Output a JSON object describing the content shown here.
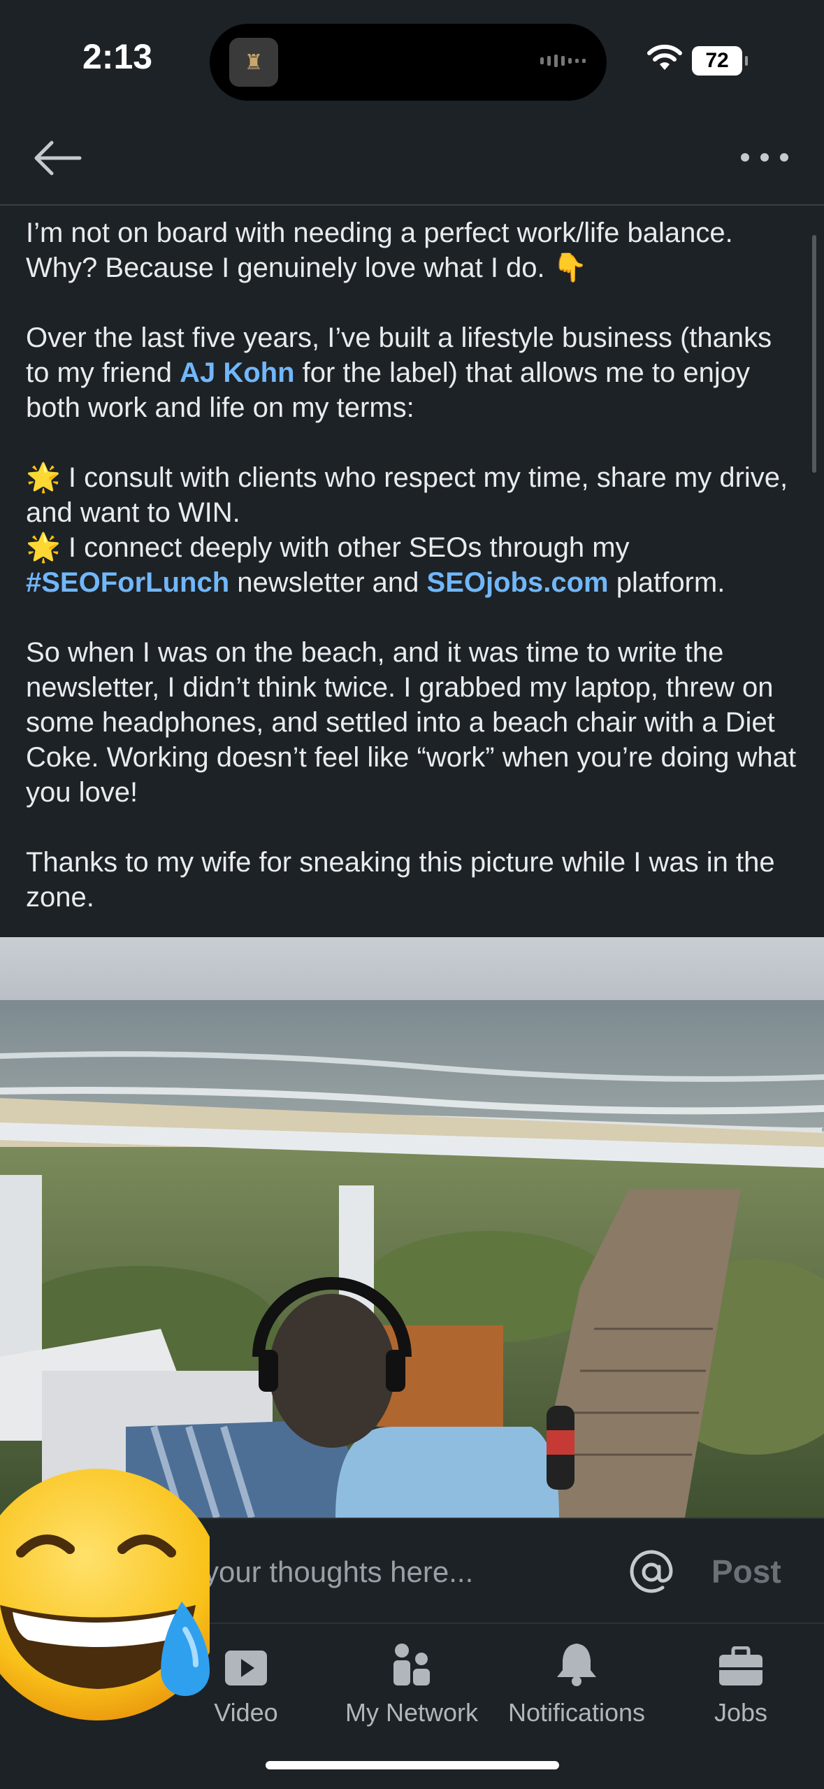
{
  "status_bar": {
    "time": "2:13",
    "battery": "72"
  },
  "post": {
    "paragraphs": [
      {
        "segments": [
          {
            "text": "I’m not on board with needing a perfect work/life balance. Why? Because I genuinely love what I do. "
          },
          {
            "text": "👇"
          }
        ]
      },
      {
        "segments": [
          {
            "text": "Over the last five years, I’ve built a lifestyle business (thanks to my friend "
          },
          {
            "text": "AJ Kohn",
            "link": true
          },
          {
            "text": " for the label) that allows me to enjoy both work and life on my terms:"
          }
        ]
      },
      {
        "segments": [
          {
            "text": "🌟 I consult with clients who respect my time, share my drive, and want to WIN."
          }
        ],
        "tight": true
      },
      {
        "segments": [
          {
            "text": "🌟 I connect deeply with other SEOs through my "
          },
          {
            "text": "#SEOForLunch",
            "link": true
          },
          {
            "text": " newsletter and "
          },
          {
            "text": "SEOjobs.com",
            "link": true
          },
          {
            "text": " platform."
          }
        ]
      },
      {
        "segments": [
          {
            "text": "So when I was on the beach, and it was time to write the newsletter, I didn’t think twice. I grabbed my laptop, threw on some headphones, and settled into a beach chair with a Diet Coke. Working doesn’t feel like “work” when you’re doing what you love!"
          }
        ]
      },
      {
        "segments": [
          {
            "text": "Thanks to my wife for sneaking this picture while I was in the zone."
          }
        ]
      }
    ]
  },
  "comment_bar": {
    "placeholder": "your thoughts here...",
    "post_label": "Post"
  },
  "tabs": [
    {
      "label": "Video",
      "icon": "video-icon"
    },
    {
      "label": "My Network",
      "icon": "network-icon"
    },
    {
      "label": "Notifications",
      "icon": "bell-icon"
    },
    {
      "label": "Jobs",
      "icon": "briefcase-icon"
    }
  ],
  "colors": {
    "background": "#1d2226",
    "link": "#71b7fb",
    "text": "#e9ebed",
    "muted": "#b0b6bb"
  }
}
